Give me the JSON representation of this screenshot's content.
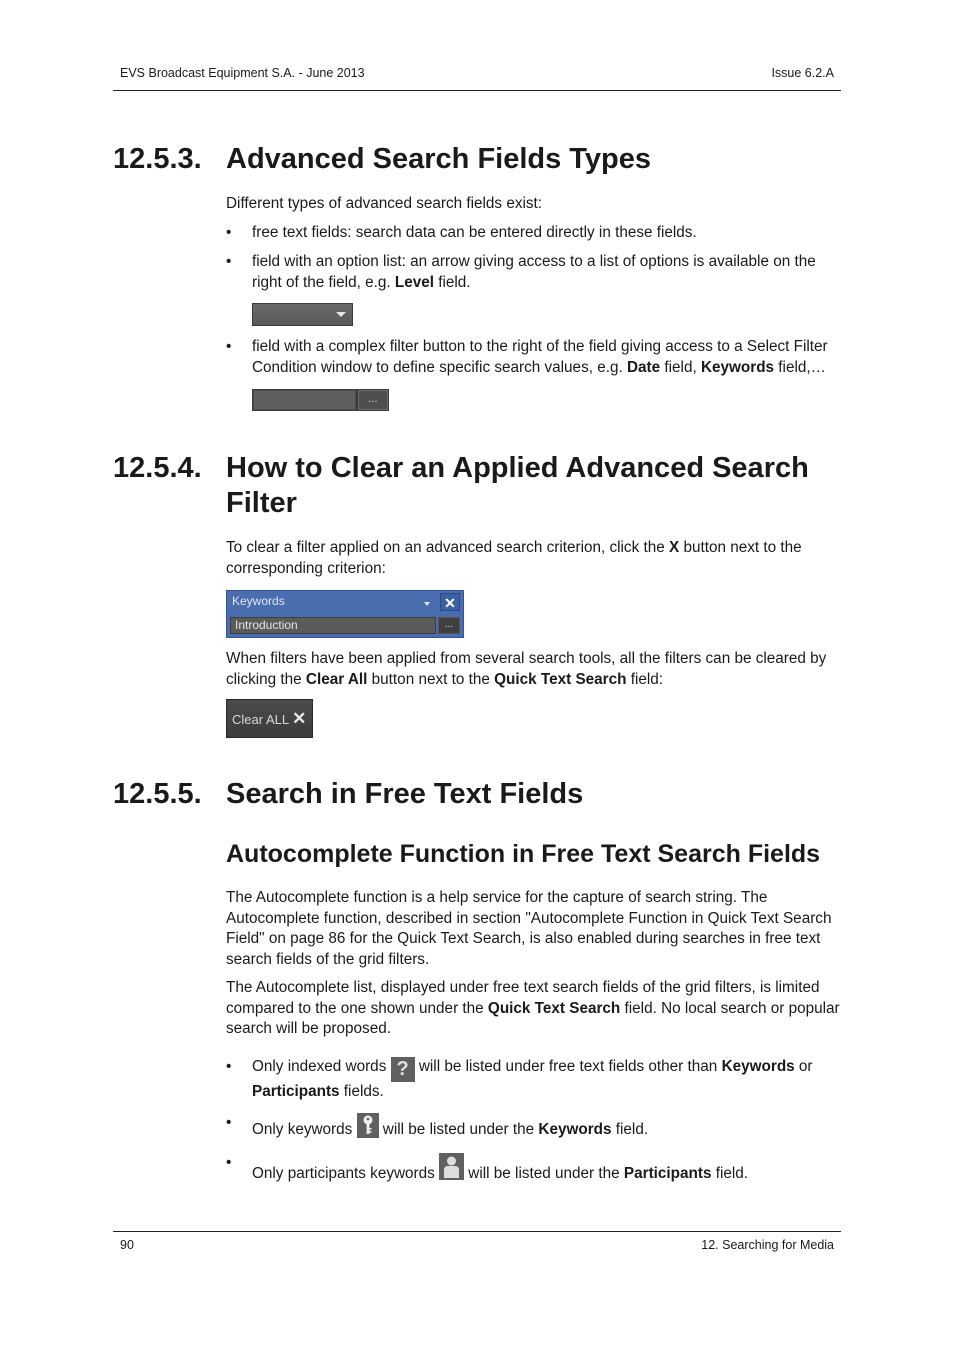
{
  "header": {
    "left": "EVS Broadcast Equipment S.A.  - June 2013",
    "right": "Issue 6.2.A"
  },
  "footer": {
    "page": "90",
    "chapter": "12. Searching for Media"
  },
  "s1": {
    "num": "12.5.3.",
    "title": "Advanced Search Fields Types",
    "intro": "Different types of advanced search fields exist:",
    "b1": "free text fields: search data can be entered directly in these fields.",
    "b2a": "field with an option list: an arrow giving access to a list of options is available on the right of the field, e.g. ",
    "b2b": "Level",
    "b2c": " field.",
    "b3a": "field with a complex filter button to the right of the field giving access to a Select Filter Condition window to define specific search values, e.g. ",
    "b3b": "Date",
    "b3c": " field, ",
    "b3d": "Keywords",
    "b3e": " field,…",
    "complex_btn": "..."
  },
  "s2": {
    "num": "12.5.4.",
    "title": "How to Clear an Applied Advanced Search Filter",
    "p1a": "To clear a filter applied on an advanced search criterion, click the ",
    "p1b": "X",
    "p1c": " button next to the corresponding criterion:",
    "kw_label": "Keywords",
    "kw_close": "✕",
    "kw_value": "Introduction",
    "kw_btn": "...",
    "p2a": "When filters have been applied from several search tools, all the filters can be cleared by clicking the ",
    "p2b": "Clear All",
    "p2c": " button next to the ",
    "p2d": "Quick Text Search",
    "p2e": " field:",
    "clear_label": "Clear ALL",
    "clear_icon": "✕"
  },
  "s3": {
    "num": "12.5.5.",
    "title": "Search in Free Text Fields",
    "sub": "Autocomplete Function in Free Text Search Fields",
    "p1": "The Autocomplete function is a help service for the capture of search string. The Autocomplete function, described in section \"Autocomplete Function in Quick Text Search Field\" on page 86 for the Quick Text Search, is also enabled during searches in free text search fields of the grid filters.",
    "p2a": "The Autocomplete list, displayed under free text search fields of the grid filters, is limited compared to the one shown under the ",
    "p2b": "Quick Text Search",
    "p2c": " field. No local search or popular search will be proposed.",
    "b1a": "Only indexed words ",
    "b1b": " will be listed under free text fields other than ",
    "b1c": "Keywords",
    "b1d": " or ",
    "b1e": "Participants",
    "b1f": " fields.",
    "b2a": "Only keywords ",
    "b2b": " will be listed under the ",
    "b2c": "Keywords",
    "b2d": " field.",
    "b3a": "Only participants keywords ",
    "b3b": " will be listed under the ",
    "b3c": "Participants",
    "b3d": " field.",
    "icons": [
      "question-icon",
      "key-icon",
      "person-icon"
    ]
  },
  "bullet": "•"
}
